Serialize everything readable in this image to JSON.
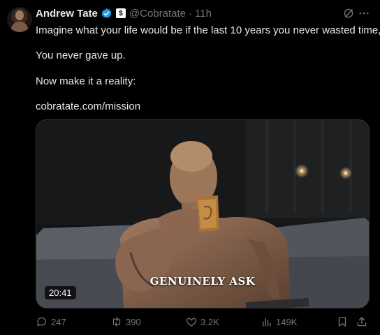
{
  "author": {
    "name": "Andrew Tate",
    "handle": "@Cobratate",
    "time": "11h",
    "affiliate_badge_text": "$"
  },
  "post": {
    "line1": "Imagine what your life would be if the last 10 years you never wasted time,",
    "line2": "You never gave up.",
    "line3": "Now make it a reality:",
    "link": "cobratate.com/mission"
  },
  "media": {
    "duration": "20:41",
    "caption": "GENUINELY ASK"
  },
  "actions": {
    "replies": "247",
    "reposts": "390",
    "likes": "3.2K",
    "views": "149K"
  },
  "colors": {
    "background": "#000000",
    "text": "#e7e9ea",
    "muted": "#71767b",
    "link": "#1d9bf0",
    "verified": "#1d9bf0"
  },
  "icons": [
    "verified-icon",
    "affiliate-badge-icon",
    "grok-icon",
    "more-icon",
    "reply-icon",
    "repost-icon",
    "like-icon",
    "views-icon",
    "bookmark-icon",
    "share-icon"
  ]
}
